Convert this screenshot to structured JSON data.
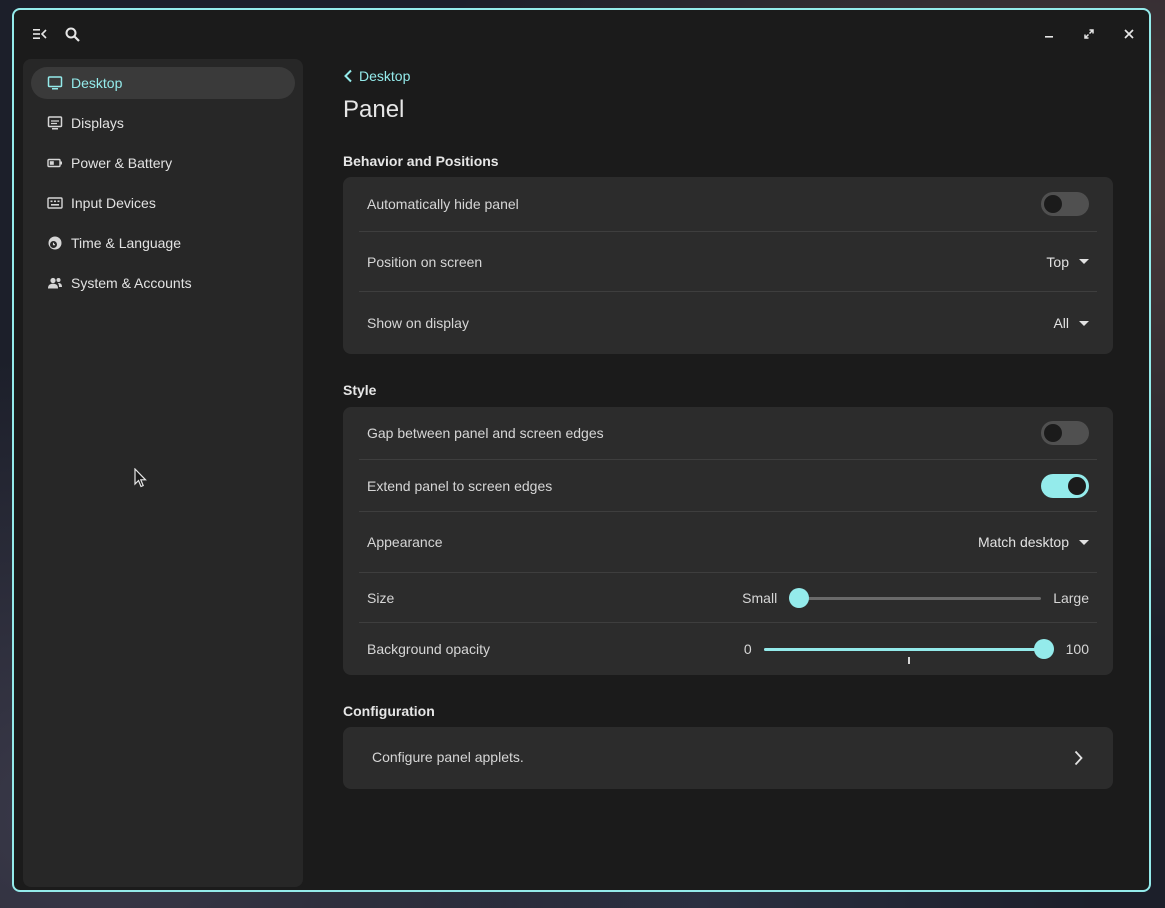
{
  "sidebar": {
    "items": [
      {
        "label": "Desktop",
        "icon": "monitor-icon",
        "active": true
      },
      {
        "label": "Displays",
        "icon": "displays-icon",
        "active": false
      },
      {
        "label": "Power & Battery",
        "icon": "battery-icon",
        "active": false
      },
      {
        "label": "Input Devices",
        "icon": "keyboard-icon",
        "active": false
      },
      {
        "label": "Time & Language",
        "icon": "globe-clock-icon",
        "active": false
      },
      {
        "label": "System & Accounts",
        "icon": "users-icon",
        "active": false
      }
    ]
  },
  "header": {
    "back_label": "Desktop",
    "title": "Panel"
  },
  "behavior": {
    "title": "Behavior and Positions",
    "auto_hide": {
      "label": "Automatically hide panel",
      "on": false
    },
    "position": {
      "label": "Position on screen",
      "value": "Top"
    },
    "display": {
      "label": "Show on display",
      "value": "All"
    }
  },
  "style": {
    "title": "Style",
    "gap": {
      "label": "Gap between panel and screen edges",
      "on": false
    },
    "extend": {
      "label": "Extend panel to screen edges",
      "on": true
    },
    "appearance": {
      "label": "Appearance",
      "value": "Match desktop"
    },
    "size": {
      "label": "Size",
      "min_label": "Small",
      "max_label": "Large",
      "value_fraction": 0.0
    },
    "opacity": {
      "label": "Background opacity",
      "min_label": "0",
      "max_label": "100",
      "value": 100
    }
  },
  "configuration": {
    "title": "Configuration",
    "applets_label": "Configure panel applets."
  },
  "colors": {
    "accent": "#94ebeb",
    "window_bg": "#1b1b1b",
    "card_bg": "#2c2c2c",
    "sidebar_bg": "#272727"
  }
}
